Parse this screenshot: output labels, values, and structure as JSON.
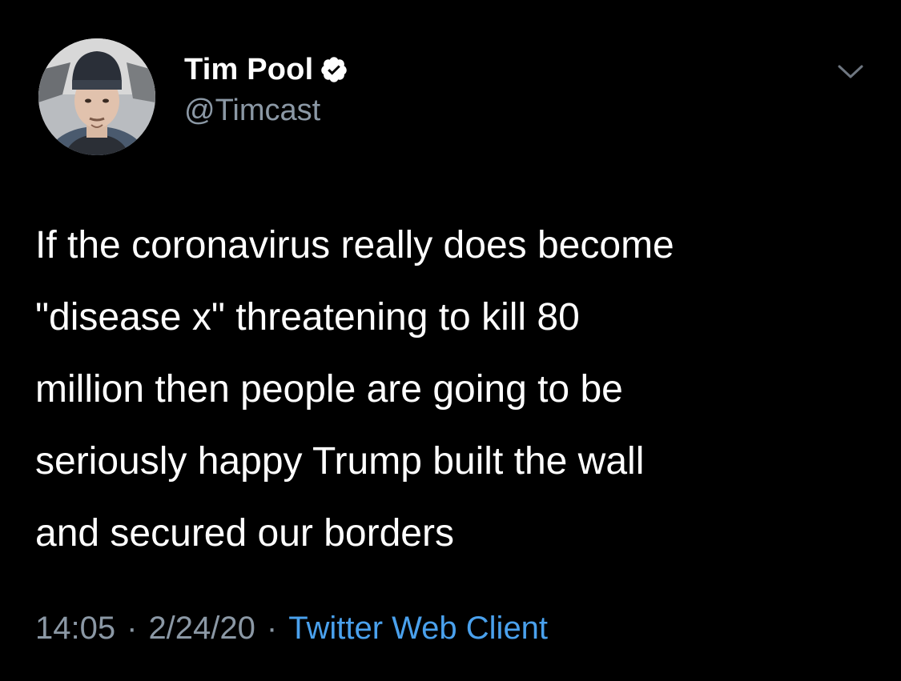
{
  "tweet": {
    "author": {
      "display_name": "Tim Pool",
      "handle": "@Timcast",
      "verified": true,
      "avatar_icon": "profile-photo-avatar"
    },
    "menu_icon": "chevron-down-icon",
    "text_lines": [
      "If the coronavirus really does become",
      "\"disease x\" threatening to kill 80",
      "million then people are going to be",
      "seriously happy Trump built the wall",
      "and secured our borders"
    ],
    "meta": {
      "time": "14:05",
      "separator": "·",
      "date": "2/24/20",
      "source": "Twitter Web Client"
    }
  },
  "colors": {
    "background": "#000000",
    "text_primary": "#ffffff",
    "text_secondary": "#8b98a5",
    "link": "#4aa1ed"
  }
}
